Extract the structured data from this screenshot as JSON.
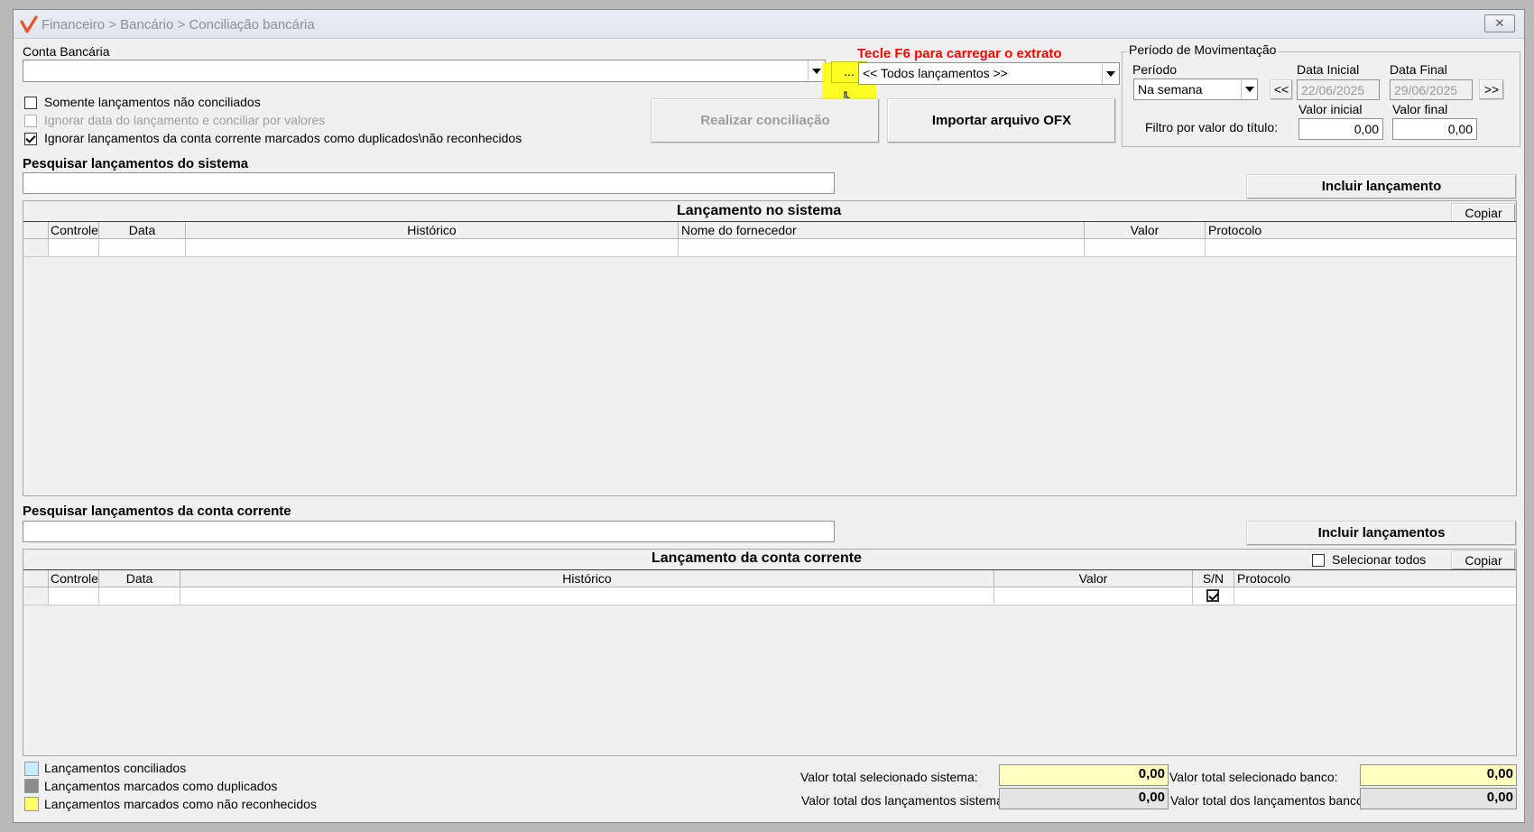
{
  "window": {
    "title": "Financeiro > Bancário > Conciliação bancária",
    "close_icon": "close-icon"
  },
  "account": {
    "label": "Conta Bancária",
    "value": "",
    "browse_label": "...",
    "f6_hint": "Tecle F6 para carregar o extrato",
    "filter_value": "<< Todos lançamentos >>"
  },
  "options": {
    "only_unreconciled": "Somente lançamentos não conciliados",
    "ignore_date": "Ignorar data do lançamento e conciliar por valores",
    "ignore_duplicated": "Ignorar lançamentos da conta corrente marcados como duplicados\\não reconhecidos"
  },
  "actions": {
    "reconcile": "Realizar conciliação",
    "import_ofx": "Importar arquivo OFX"
  },
  "period": {
    "group_title": "Período de Movimentação",
    "period_label": "Período",
    "period_value": "Na semana",
    "start_label": "Data Inicial",
    "start_value": "22/06/2025",
    "end_label": "Data Final",
    "end_value": "29/06/2025",
    "prev_label": "<<",
    "next_label": ">>",
    "min_label": "Valor inicial",
    "min_value": "0,00",
    "max_label": "Valor final",
    "max_value": "0,00",
    "filter_label": "Filtro por valor do título:"
  },
  "system": {
    "search_label": "Pesquisar lançamentos do sistema",
    "include_button": "Incluir lançamento",
    "grid_title": "Lançamento no sistema",
    "copy_button": "Copiar",
    "columns": [
      "Controle",
      "Data",
      "Histórico",
      "Nome do fornecedor",
      "Valor",
      "Protocolo"
    ]
  },
  "bank": {
    "search_label": "Pesquisar lançamentos da conta corrente",
    "include_button": "Incluir lançamentos",
    "grid_title": "Lançamento da conta corrente",
    "select_all": "Selecionar todos",
    "copy_button": "Copiar",
    "columns": [
      "Controle",
      "Data",
      "Histórico",
      "Valor",
      "S/N",
      "Protocolo"
    ]
  },
  "legend": {
    "items": [
      {
        "label": "Lançamentos conciliados",
        "color": "#c8ecff"
      },
      {
        "label": "Lançamentos marcados como duplicados",
        "color": "#8c8c8c"
      },
      {
        "label": "Lançamentos marcados como não reconhecidos",
        "color": "#ffff66"
      }
    ]
  },
  "totals": {
    "selected_system_label": "Valor total selecionado sistema:",
    "selected_system_value": "0,00",
    "total_system_label": "Valor total dos lançamentos sistema:",
    "total_system_value": "0,00",
    "selected_bank_label": "Valor total selecionado banco:",
    "selected_bank_value": "0,00",
    "total_bank_label": "Valor total dos lançamentos banco:",
    "total_bank_value": "0,00"
  },
  "colors": {
    "hint_red": "#ff0000",
    "highlight_yellow": "#ffff00",
    "total_selected_bg": "#ffffc0",
    "total_readonly_bg": "#e4e4e4"
  }
}
